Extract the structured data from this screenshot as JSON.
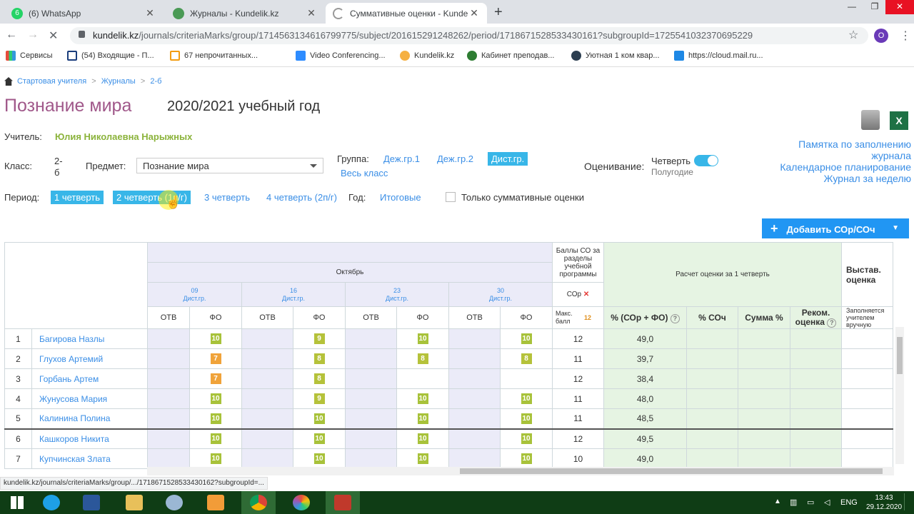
{
  "browser": {
    "tabs": [
      {
        "title": "(6) WhatsApp",
        "color": "#25d366",
        "active": false
      },
      {
        "title": "Журналы - Kundelik.kz",
        "color": "#4a9a55",
        "active": false
      },
      {
        "title": "Суммативные оценки - Kundelik.kz",
        "color": "#aaaaaa",
        "active": true
      }
    ],
    "url_host": "kundelik.kz",
    "url_path": "/journals/criteriaMarks/group/1714563134616799775/subject/201615291248262/period/1718671528533430161?subgroupId=1725541032370695229",
    "profile_initial": "O",
    "bookmarks": [
      "Сервисы",
      "(54) Входящие - П...",
      "67 непрочитанных...",
      "Video Conferencing...",
      "Kundelik.kz",
      "Кабинет преподав...",
      "Уютная 1 ком квар...",
      "https://cloud.mail.ru..."
    ],
    "status_url": "kundelik.kz/journals/criteriaMarks/group/.../1718671528533430162?subgroupId=..."
  },
  "breadcrumb": [
    "Стартовая учителя",
    "Журналы",
    "2-б"
  ],
  "subject_title": "Познание мира",
  "year": "2020/2021 учебный год",
  "teacher_label": "Учитель:",
  "teacher_name": "Юлия Николаевна Нарыжных",
  "class_label": "Класс:",
  "class_value": "2-б",
  "subject_label": "Предмет:",
  "subject_value": "Познание мира",
  "group_label": "Группа:",
  "groups": [
    "Деж.гр.1",
    "Деж.гр.2",
    "Дист.гр.",
    "Весь класс"
  ],
  "grading_label": "Оценивание:",
  "grading_on": "Четверть",
  "grading_off": "Полугодие",
  "right_links": [
    "Памятка по заполнению",
    "журнала",
    "Календарное планирование",
    "Журнал за неделю"
  ],
  "period_label": "Период:",
  "periods": [
    "1 четверть",
    "2 четверть (1п/г)",
    "3 четверть",
    "4 четверть (2п/г)"
  ],
  "year_label": "Год:",
  "year_link": "Итоговые",
  "only_summative": "Только суммативные оценки",
  "add_button": "Добавить СОр/СОч",
  "table": {
    "month": "Октябрь",
    "dates": [
      {
        "day": "09",
        "grp": "Дист.гр."
      },
      {
        "day": "16",
        "grp": "Дист.гр."
      },
      {
        "day": "23",
        "grp": "Дист.гр."
      },
      {
        "day": "30",
        "grp": "Дист.гр."
      }
    ],
    "col_otv": "ОТВ",
    "col_fo": "ФО",
    "balls_header": "Баллы СО за разделы учебной программы",
    "sor": "СОр",
    "max_label": "Макс. балл",
    "max_value": "12",
    "calc_header": "Расчет оценки за 1 четверть",
    "pct_sor_fo": "% (СОр + ФО)",
    "pct_soch": "% СОч",
    "sum_pct": "Сумма %",
    "rec": "Реком. оценка",
    "vystav": "Выстав. оценка",
    "vystav_note": "Заполняется учителем вручную",
    "rows": [
      {
        "n": "1",
        "name": "Багирова Назлы",
        "fo": [
          "10",
          "9",
          "10",
          "10"
        ],
        "sor": "12",
        "pct": "49,0"
      },
      {
        "n": "2",
        "name": "Глухов Артемий",
        "fo": [
          "7",
          "8",
          "8",
          "8"
        ],
        "sor": "11",
        "pct": "39,7"
      },
      {
        "n": "3",
        "name": "Горбань Артем",
        "fo": [
          "7",
          "8",
          "",
          ""
        ],
        "sor": "12",
        "pct": "38,4"
      },
      {
        "n": "4",
        "name": "Жунусова Мария",
        "fo": [
          "10",
          "9",
          "10",
          "10"
        ],
        "sor": "11",
        "pct": "48,0"
      },
      {
        "n": "5",
        "name": "Калинина Полина",
        "fo": [
          "10",
          "10",
          "10",
          "10"
        ],
        "sor": "11",
        "pct": "48,5"
      },
      {
        "n": "6",
        "name": "Кашкоров Никита",
        "fo": [
          "10",
          "10",
          "10",
          "10"
        ],
        "sor": "12",
        "pct": "49,5"
      },
      {
        "n": "7",
        "name": "Купчинская Злата",
        "fo": [
          "10",
          "10",
          "10",
          "10"
        ],
        "sor": "10",
        "pct": "49,0"
      }
    ]
  },
  "colors": {
    "accent": "#38b6e8",
    "title": "#a0588a",
    "teacher": "#8bb33b",
    "mark10": "#a8c23a",
    "mark_low": "#f0a33a"
  },
  "taskbar": {
    "lang": "ENG",
    "time": "13:43",
    "date": "29.12.2020"
  }
}
